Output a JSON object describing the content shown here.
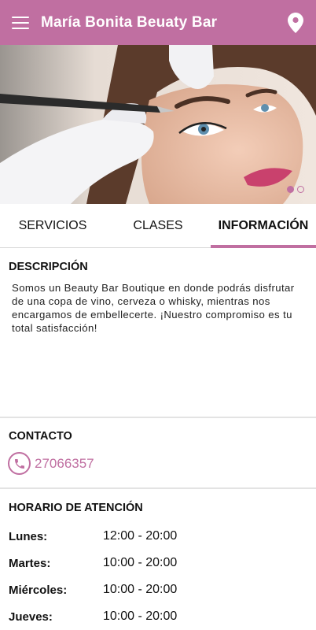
{
  "appbar": {
    "title": "María Bonita Beuaty Bar",
    "menu_icon": "hamburger-menu-icon",
    "location_icon": "location-pin-icon"
  },
  "colors": {
    "primary": "#c06fa1"
  },
  "carousel": {
    "slides": 2,
    "active_index": 0
  },
  "tabs": [
    {
      "label": "SERVICIOS",
      "active": false
    },
    {
      "label": "CLASES",
      "active": false
    },
    {
      "label": "INFORMACIÓN",
      "active": true
    }
  ],
  "description": {
    "title": "DESCRIPCIÓN",
    "text": "Somos un Beauty Bar Boutique en donde podrás disfrutar de una copa de vino, cerveza o whisky, mientras nos encargamos de embellecerte. ¡Nuestro compromiso es tu total satisfacción!"
  },
  "contact": {
    "title": "CONTACTO",
    "phone": "27066357"
  },
  "hours": {
    "title": "HORARIO DE ATENCIÓN",
    "rows": [
      {
        "day": "Lunes:",
        "time": "12:00 - 20:00"
      },
      {
        "day": "Martes:",
        "time": "10:00 - 20:00"
      },
      {
        "day": "Miércoles:",
        "time": "10:00 - 20:00"
      },
      {
        "day": "Jueves:",
        "time": "10:00 - 20:00"
      }
    ]
  }
}
